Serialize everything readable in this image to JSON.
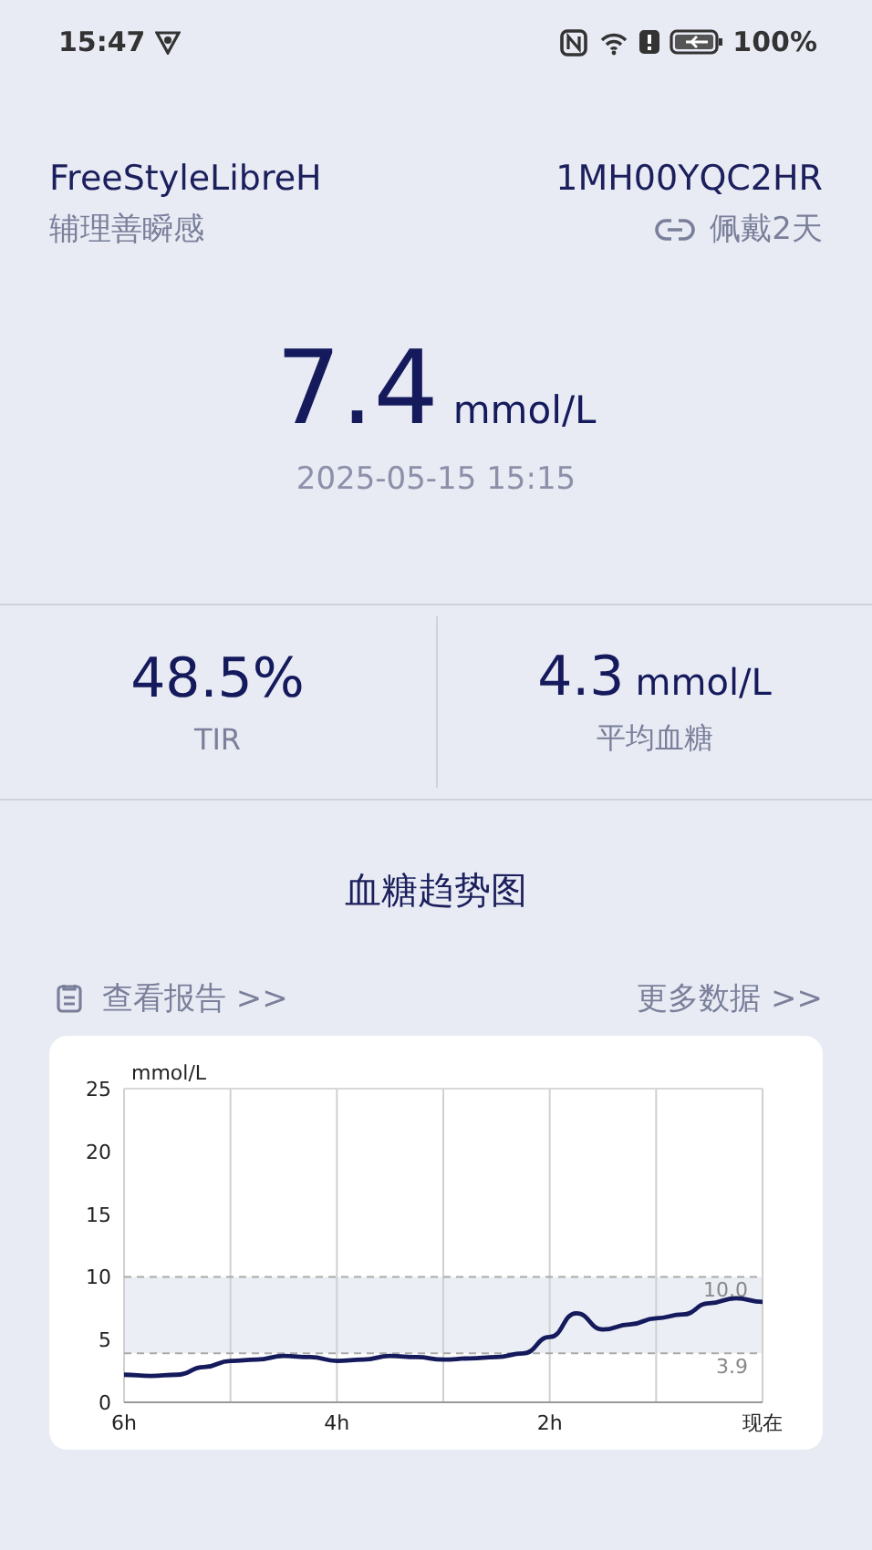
{
  "status_bar": {
    "time": "15:47",
    "battery": "100%"
  },
  "device": {
    "name": "FreeStyleLibreH",
    "serial": "1MH00YQC2HR",
    "brand": "辅理善瞬感",
    "wear": "佩戴2天"
  },
  "reading": {
    "value": "7.4",
    "unit": "mmol/L",
    "time": "2025-05-15 15:15"
  },
  "stats": [
    {
      "value": "48.5%",
      "label": "TIR"
    },
    {
      "value": "4.3",
      "unit": "mmol/L",
      "label": "平均血糖"
    }
  ],
  "chart_title": "血糖趋势图",
  "links": [
    {
      "label": "查看报告 >>",
      "kind": "report"
    },
    {
      "label": "更多数据 >>",
      "kind": "more"
    }
  ],
  "chart": {
    "chart_data": {
      "type": "line",
      "ylabel": "mmol/L",
      "x": [
        -6,
        -5.75,
        -5.5,
        -5.25,
        -5,
        -4.75,
        -4.5,
        -4.25,
        -4,
        -3.75,
        -3.5,
        -3.25,
        -3,
        -2.75,
        -2.5,
        -2.25,
        -2,
        -1.75,
        -1.5,
        -1.25,
        -1,
        -0.75,
        -0.5,
        -0.25,
        0
      ],
      "series": [
        {
          "color": "#141a5c",
          "values": [
            2.2,
            2.1,
            2.2,
            2.8,
            3.3,
            3.4,
            3.7,
            3.6,
            3.3,
            3.4,
            3.7,
            3.6,
            3.4,
            3.5,
            3.6,
            3.9,
            5.2,
            7.1,
            5.8,
            6.2,
            6.7,
            7.0,
            7.9,
            8.3,
            8.0
          ]
        }
      ],
      "xlim": [
        -6,
        0
      ],
      "ylim": [
        0,
        25
      ],
      "xticks": [
        {
          "value": -6,
          "label": "6h"
        },
        {
          "value": -4,
          "label": "4h"
        },
        {
          "value": -2,
          "label": "2h"
        },
        {
          "value": 0,
          "label": "现在"
        }
      ],
      "yticks": [
        0,
        5,
        10,
        15,
        20,
        25
      ],
      "ref_lines": [
        {
          "axis": "y",
          "value": 10,
          "label": "10.0"
        },
        {
          "axis": "y",
          "value": 3.9,
          "label": "3.9"
        }
      ],
      "bands": [
        {
          "axis": "y",
          "from": 3.9,
          "to": 10
        }
      ]
    }
  }
}
